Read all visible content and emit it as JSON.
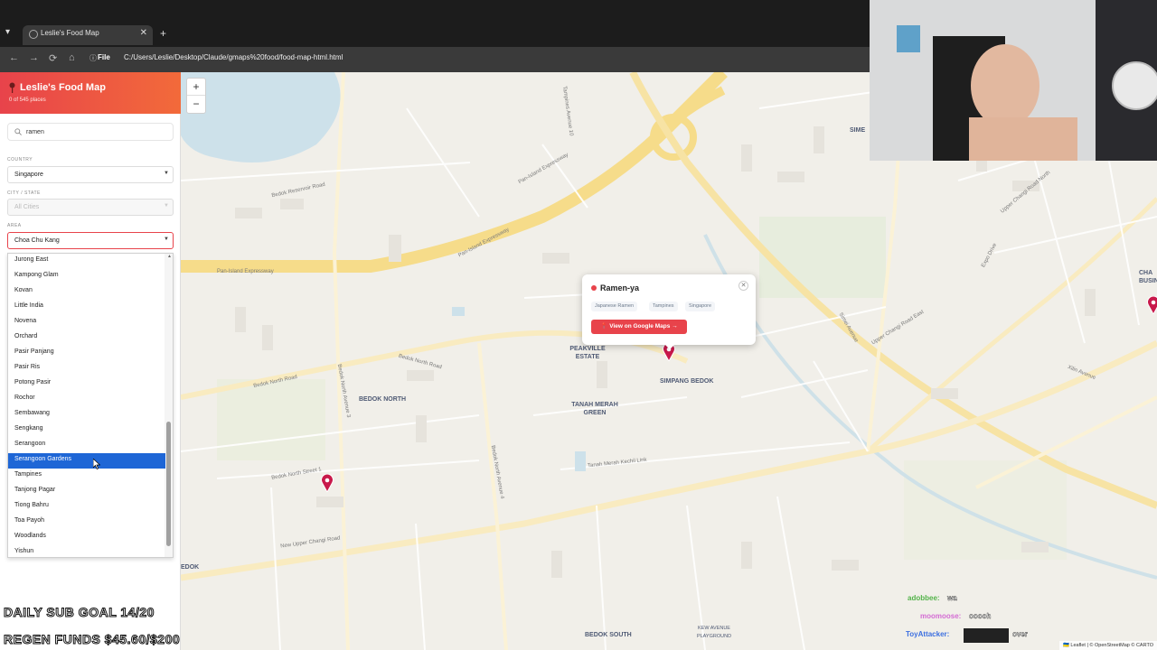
{
  "browser": {
    "tab_title": "Leslie's Food Map",
    "tab_close": "✕",
    "new_tab": "+",
    "file_chip": "File",
    "url": "C:/Users/Leslie/Desktop/Claude/gmaps%20food/food-map-html.html",
    "nav": {
      "menu": "▾",
      "back": "←",
      "forward": "→",
      "reload": "⟳",
      "home": "⌂",
      "info": "ⓘ"
    }
  },
  "sidebar": {
    "title": "Leslie's Food Map",
    "count": "0 of 545 places",
    "search": {
      "value": "ramen",
      "placeholder": "Search"
    },
    "country": {
      "label": "COUNTRY",
      "value": "Singapore"
    },
    "city": {
      "label": "CITY / STATE",
      "value": "All Cities"
    },
    "area": {
      "label": "AREA",
      "value": "Choa Chu Kang"
    },
    "dropdown": {
      "items": [
        "Jurong East",
        "Kampong Glam",
        "Kovan",
        "Little India",
        "Novena",
        "Orchard",
        "Pasir Panjang",
        "Pasir Ris",
        "Potong Pasir",
        "Rochor",
        "Sembawang",
        "Sengkang",
        "Serangoon",
        "Serangoon Gardens",
        "Tampines",
        "Tanjong Pagar",
        "Tiong Bahru",
        "Toa Payoh",
        "Woodlands",
        "Yishun"
      ],
      "highlighted": "Serangoon Gardens"
    }
  },
  "map": {
    "zoom_in": "+",
    "zoom_out": "−",
    "area_labels": [
      "BEDOK NORTH",
      "PEAKVILLE ESTATE",
      "TANAH MERAH GREEN",
      "SIMPANG BEDOK",
      "BEDOK SOUTH",
      "KEW AVENUE PLAYGROUND",
      "CHA BUSINES",
      "SIME",
      "EDOK"
    ],
    "road_labels": [
      "Pan-Island Expressway",
      "Pan-Island Expressway",
      "Pan-Island Expressway",
      "Bedok Reservoir Road",
      "Bedok North Road",
      "Bedok North Road",
      "Bedok North Avenue 3",
      "Bedok North Street 1",
      "New Upper Changi Road",
      "Upper Changi Road East",
      "Xilin Avenue",
      "Simei Avenue",
      "Expo Drive",
      "Upper Changi Road North",
      "Bedok North Avenue 4",
      "Tampines Avenue 10",
      "Tanah Merah Kechil Link"
    ],
    "popup": {
      "title": "Ramen-ya",
      "tags": [
        "Japanese Ramen",
        "Tampines",
        "Singapore"
      ],
      "button": "📍 View on Google Maps →",
      "close": "✕"
    },
    "attribution": "🇺🇦 Leaflet | © OpenStreetMap © CARTO"
  },
  "stream": {
    "goal_line1": "DAILY SUB GOAL 14/20",
    "goal_line2": "REGEN FUNDS $45.60/$200",
    "chat": [
      {
        "user": "adobbee:",
        "message": "wa"
      },
      {
        "user": "moomoose:",
        "message": "ooooh"
      },
      {
        "user": "ToyAttacker:",
        "message": "over"
      }
    ]
  },
  "colors": {
    "brand": "#e8434b",
    "highlight": "#1e66d6",
    "map_bg": "#f1efe9",
    "road_major": "#f6dc8a"
  }
}
